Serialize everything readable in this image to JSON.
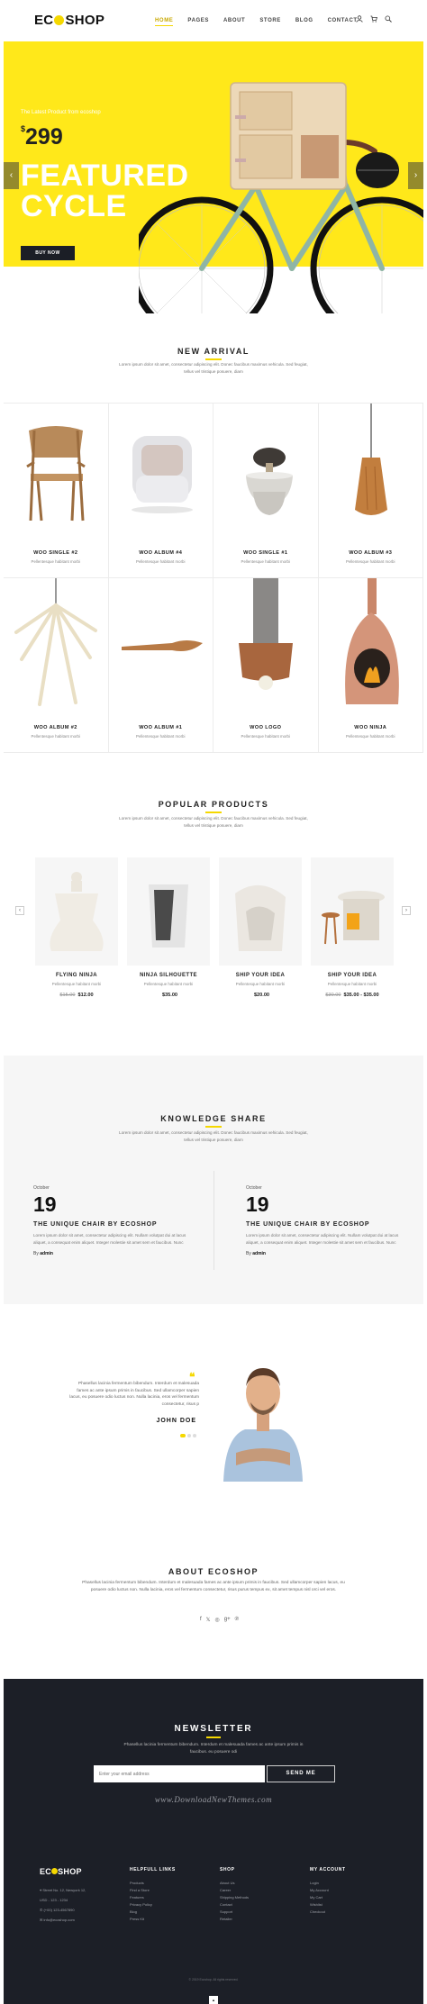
{
  "header": {
    "logo_left": "EC",
    "logo_right": "SHOP",
    "nav": [
      "HOME",
      "PAGES",
      "ABOUT",
      "STORE",
      "BLOG",
      "CONTACT"
    ]
  },
  "hero": {
    "small": "The Latest Product from ecoshop",
    "currency": "$",
    "price": "299",
    "title_line1": "FEATURED",
    "title_line2": "CYCLE",
    "button": "BUY NOW"
  },
  "new_arrival": {
    "title": "NEW ARRIVAL",
    "desc": "Lorem ipsum dolor sit amet, consectetur adipiscing elit. Donec faucibus maximus vehicula. Sed feugiat, tellus vel tristique posuere, diam",
    "items": [
      {
        "name": "WOO SINGLE #2",
        "sub": "Pellentesque habitant morbi"
      },
      {
        "name": "WOO ALBUM #4",
        "sub": "Pellentesque habitant morbi"
      },
      {
        "name": "WOO SINGLE #1",
        "sub": "Pellentesque habitant morbi"
      },
      {
        "name": "WOO ALBUM #3",
        "sub": "Pellentesque habitant morbi"
      },
      {
        "name": "WOO ALBUM #2",
        "sub": "Pellentesque habitant morbi"
      },
      {
        "name": "WOO ALBUM #1",
        "sub": "Pellentesque habitant morbi"
      },
      {
        "name": "WOO LOGO",
        "sub": "Pellentesque habitant morbi"
      },
      {
        "name": "WOO NINJA",
        "sub": "Pellentesque habitant morbi"
      }
    ]
  },
  "popular": {
    "title": "POPULAR PRODUCTS",
    "desc": "Lorem ipsum dolor sit amet, consectetur adipiscing elit. Donec faucibus maximus vehicula. Sed feugiat, tellus vel tristique posuere, diam",
    "items": [
      {
        "name": "FLYING NINJA",
        "sub": "Pellentesque habitant morbi",
        "old": "$15.00",
        "price": "$12.00"
      },
      {
        "name": "NINJA SILHOUETTE",
        "sub": "Pellentesque habitant morbi",
        "old": "",
        "price": "$35.00"
      },
      {
        "name": "SHIP YOUR IDEA",
        "sub": "Pellentesque habitant morbi",
        "old": "",
        "price": "$20.00"
      },
      {
        "name": "SHIP YOUR IDEA",
        "sub": "Pellentesque habitant morbi",
        "old": "$30.00",
        "price": "$35.00 - $35.00"
      }
    ]
  },
  "knowledge": {
    "title": "KNOWLEDGE SHARE",
    "desc": "Lorem ipsum dolor sit amet, consectetur adipiscing elit. Donec faucibus maximus vehicula. Sed feugiat, tellus vel tristique posuere, diam",
    "posts": [
      {
        "month": "October",
        "day": "19",
        "title": "THE UNIQUE CHAIR BY ECOSHOP",
        "text": "Lorem ipsum dolor sit amet, consectetur adipiscing elit. Nullam volutpat dui at lacus aliquet, a consequat enim aliquet. Integer molestie sit amet sem et faucibus. Nunc",
        "by": "By",
        "author": "admin"
      },
      {
        "month": "October",
        "day": "19",
        "title": "THE UNIQUE CHAIR BY ECOSHOP",
        "text": "Lorem ipsum dolor sit amet, consectetur adipiscing elit. Nullam volutpat dui at lacus aliquet, a consequat enim aliquet. Integer molestie sit amet sem et faucibus. Nunc",
        "by": "By",
        "author": "admin"
      }
    ]
  },
  "testimonial": {
    "quote": "Phasellus lacinia fermentum bibendum. Interdum et malesuada fames ac ante ipsum primis in faucibus. Sed ullamcorper sapien lacus, eu posuere odio luctus non. Nulla lacinia, eros vel fermentum consectetur, risus p",
    "name": "JOHN DOE"
  },
  "about": {
    "title": "ABOUT ECOSHOP",
    "desc": "Phasellus lacinia fermentum bibendum. Interdum et malesuada fames ac ante ipsum primis in faucibus. Sed ullamcorper sapien lacus, eu posuere odio luctus non. Nulla lacinia, eros vel fermentum consectetur, risus purus tempus ex, sit amet tempus nisl orci vel eros."
  },
  "newsletter": {
    "title": "NEWSLETTER",
    "desc": "Phasellus lacinia fermentum bibendum. Interdum et malesuada fames ac ante ipsum primis in faucibus. eu posuere odi",
    "placeholder": "Enter your email address",
    "button": "SEND ME",
    "watermark": "www.DownloadNewThemes.com"
  },
  "footer": {
    "logo_left": "EC",
    "logo_right": "SHOP",
    "info": [
      "Street No. 12, Newyork 12,",
      "USD - 123 - 1234",
      "(+00) 123-4567890",
      "info@ecoshop.com"
    ],
    "cols": [
      {
        "title": "HELPFULL LINKS",
        "items": [
          "Products",
          "Find a Store",
          "Features",
          "Privacy Policy",
          "Blog",
          "Press Kit"
        ]
      },
      {
        "title": "SHOP",
        "items": [
          "About Us",
          "Career",
          "Shipping Methods",
          "Contact",
          "Support",
          "Retailer"
        ]
      },
      {
        "title": "MY ACCOUNT",
        "items": [
          "Login",
          "My Account",
          "My Cart",
          "Wishlist",
          "Checkout"
        ]
      }
    ],
    "copyright": "© 2019 Ecoshop. All rights reserved."
  },
  "colors": {
    "accent": "#f5d800",
    "hero_bg": "#ffe81a",
    "dark": "#1c1f27"
  }
}
